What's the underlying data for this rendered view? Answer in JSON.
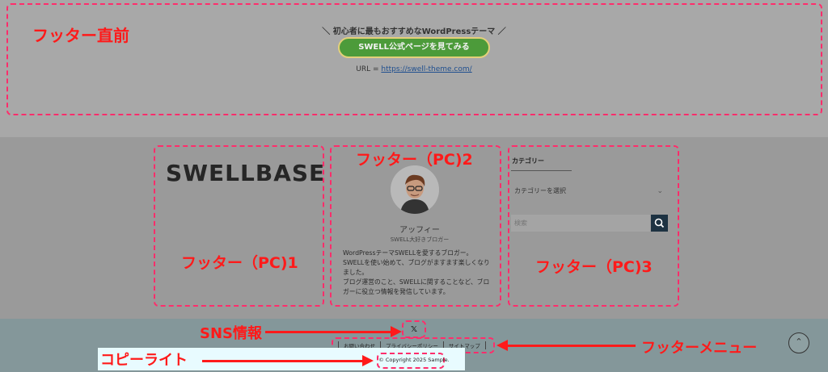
{
  "pre_footer": {
    "tagline": "＼ 初心者に最もおすすめなWordPressテーマ ／",
    "button_label": "SWELL公式ページを見てみる",
    "url_prefix": "URL = ",
    "url": "https://swell-theme.com/"
  },
  "footer_widget_1": {
    "logo_text": "SWELLBASE"
  },
  "footer_widget_2": {
    "name": "アッフィー",
    "role": "SWELL大好きブロガー",
    "bio_lines": [
      "WordPressテーマSWELLを愛するブロガー。",
      "SWELLを使い始めて、ブログがますます楽しくなり",
      "ました。",
      "ブログ運営のこと、SWELLに関することなど、ブロ",
      "ガーに役立つ情報を発信しています。"
    ]
  },
  "footer_widget_3": {
    "heading": "カテゴリー",
    "select_placeholder": "カテゴリーを選択",
    "search_placeholder": "検索"
  },
  "sns": {
    "icon_label": "𝕏"
  },
  "footer_menu": {
    "items": [
      "お問い合わせ",
      "プライバシーポリシー",
      "サイトマップ"
    ]
  },
  "copyright": "© Copyright 2025 Sample.",
  "annotations": {
    "pre_footer": "フッター直前",
    "pc1": "フッター（PC)1",
    "pc2": "フッター（PC)2",
    "pc3": "フッター（PC)3",
    "sns": "SNS情報",
    "footer_menu": "フッターメニュー",
    "copyright": "コピーライト"
  },
  "colors": {
    "annotation_red": "#ff1a1a",
    "dash_pink": "#ff2d6b",
    "cta_green": "#4c9b3a",
    "search_button": "#1d3242",
    "footer_bottom": "#84979a"
  }
}
